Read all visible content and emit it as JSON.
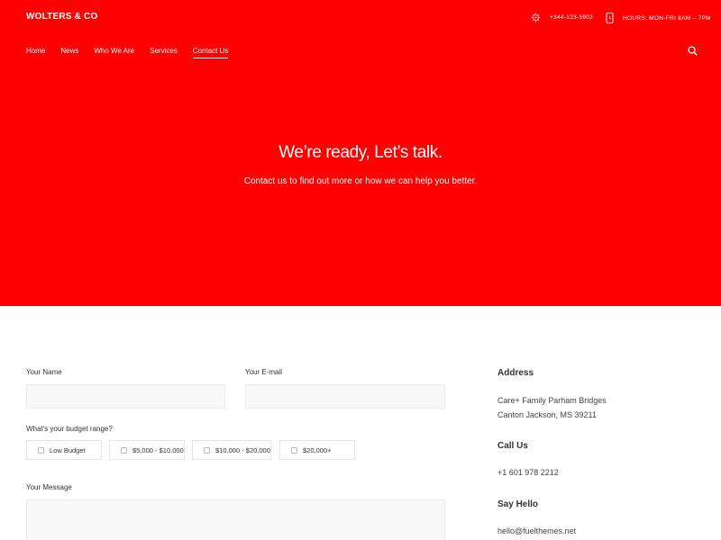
{
  "brand": {
    "logo": "WOLTERS & CO",
    "accent_color": "#ff0000"
  },
  "topbar": {
    "phone": {
      "icon": "phone-icon",
      "text": "+344-123-5902"
    },
    "hours": {
      "icon": "clock-icon",
      "text": "HOURS: MON-FRI 8AM – 7PM"
    }
  },
  "nav": {
    "items": [
      {
        "label": "Home"
      },
      {
        "label": "News"
      },
      {
        "label": "Who We Are"
      },
      {
        "label": "Services"
      },
      {
        "label": "Contact Us",
        "active": true
      }
    ],
    "search_icon": "search-icon"
  },
  "hero": {
    "title": "We’re ready, Let’s talk.",
    "subtitle": "Contact us to find out more or how we can help you better."
  },
  "form": {
    "name_label": "Your Name",
    "email_label": "Your E-mail",
    "budget_label": "What's your budget range?",
    "budget_options": [
      "Low Budget",
      "$5,000 - $10,000",
      "$10,000 - $20,000",
      "$20,000+"
    ],
    "message_label": "Your Message"
  },
  "contact": {
    "address_heading": "Address",
    "address_line1": "Care+ Family Parham Bridges",
    "address_line2": "Canton Jackson, MS 39211",
    "call_heading": "Call Us",
    "phone": "+1 601 978 2212",
    "hello_heading": "Say Hello",
    "email": "hello@fuelthemes.net"
  }
}
